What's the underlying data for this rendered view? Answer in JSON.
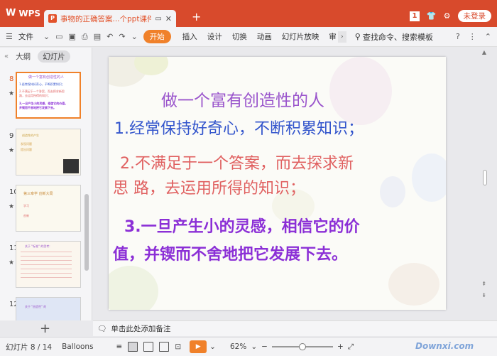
{
  "titlebar": {
    "app_name": "WPS",
    "doc_tab_title": "事物的正确答案...个ppt课件1",
    "window_count": "1",
    "login_label": "未登录"
  },
  "ribbon": {
    "file_label": "文件",
    "tabs": [
      "开始",
      "插入",
      "设计",
      "切换",
      "动画",
      "幻灯片放映",
      "审"
    ],
    "search_label": "查找命令、搜索模板"
  },
  "left_panel": {
    "tab_outline": "大纲",
    "tab_slides": "幻灯片",
    "thumbnails": [
      {
        "number": "8",
        "selected": true
      },
      {
        "number": "9",
        "selected": false
      },
      {
        "number": "10",
        "selected": false
      },
      {
        "number": "11",
        "selected": false
      },
      {
        "number": "12",
        "selected": false
      }
    ],
    "thumb8_lines": [
      "做一个富有创造性的人",
      "1.经常保持好奇心，不断积累知识；",
      "2.不满足于一个答案，而去探求新思",
      "路，去运用所得的知识；",
      "3.一旦产生小的灵感，相信它的价值，",
      "并锲而不舍地把它发展下去。"
    ],
    "thumb9_lines": [
      "创造性的产生",
      "发现问题",
      "提出问题"
    ],
    "thumb10_lines": [
      "第三章学 创新大局",
      "学习",
      "创新"
    ],
    "thumb11_lines": [
      "关于 \"标准\" 的思考:"
    ],
    "thumb12_lines": [
      "关于 \"创造性\" 的"
    ]
  },
  "slide": {
    "title": "做一个富有创造性的人",
    "line1": "1.经常保持好奇心，不断积累知识；",
    "line2": "2.不满足于一个答案，而去探求新",
    "line3": "思  路，去运用所得的知识；",
    "line4": "3.一旦产生小的灵感，相信它的价",
    "line5": "值，并锲而不舍地把它发展下去。"
  },
  "notes": {
    "placeholder": "单击此处添加备注"
  },
  "status": {
    "slide_counter": "幻灯片 8 / 14",
    "theme": "Balloons",
    "zoom": "62%",
    "watermark": "Downxi.com"
  },
  "colors": {
    "brand": "#d84a2c",
    "accent": "#f0812a",
    "title_purple": "#9a55cc",
    "line_blue": "#3355cc",
    "line_red": "#e06060",
    "line_violet": "#8b2fd6"
  }
}
